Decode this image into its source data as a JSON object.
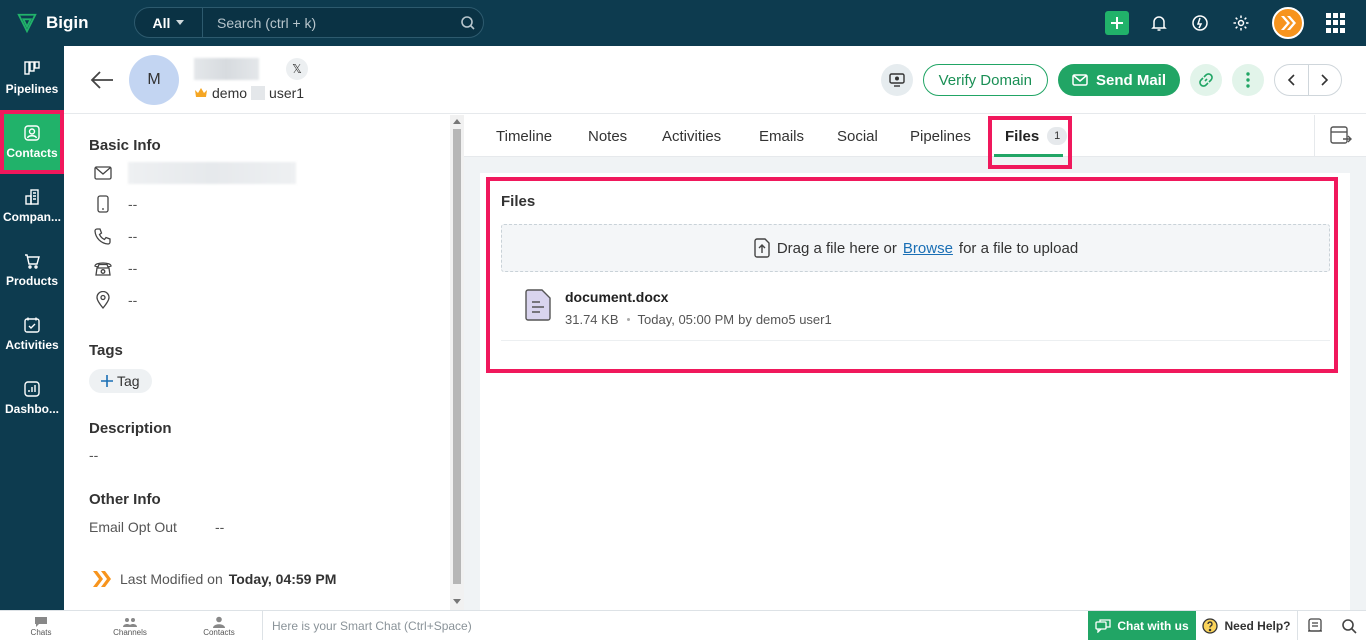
{
  "app": {
    "name": "Bigin"
  },
  "search": {
    "scope": "All",
    "placeholder": "Search (ctrl + k)"
  },
  "nav": {
    "items": [
      {
        "label": "Pipelines"
      },
      {
        "label": "Contacts"
      },
      {
        "label": "Compan..."
      },
      {
        "label": "Products"
      },
      {
        "label": "Activities"
      },
      {
        "label": "Dashbo..."
      }
    ]
  },
  "contact": {
    "avatar_initial": "M",
    "owner_prefix": "demo",
    "owner_suffix": "user1"
  },
  "header": {
    "verify_label": "Verify Domain",
    "send_label": "Send Mail"
  },
  "details": {
    "basic_info_title": "Basic Info",
    "mobile": "--",
    "phone": "--",
    "home_phone": "--",
    "address": "--",
    "tags_title": "Tags",
    "tag_button": "Tag",
    "description_title": "Description",
    "description_value": "--",
    "other_info_title": "Other Info",
    "email_opt_out_label": "Email Opt Out",
    "email_opt_out_value": "--",
    "last_modified_label": "Last Modified on",
    "last_modified_value": "Today, 04:59 PM"
  },
  "tabs": [
    {
      "label": "Timeline"
    },
    {
      "label": "Notes"
    },
    {
      "label": "Activities"
    },
    {
      "label": "Emails"
    },
    {
      "label": "Social"
    },
    {
      "label": "Pipelines"
    },
    {
      "label": "Files",
      "count": "1"
    }
  ],
  "files": {
    "title": "Files",
    "drop_prefix": "Drag a file here or",
    "drop_link": "Browse",
    "drop_suffix": "for a file to upload",
    "items": [
      {
        "name": "document.docx",
        "size": "31.74 KB",
        "time": "Today, 05:00 PM",
        "by_label": "by",
        "user": "demo5 user1"
      }
    ]
  },
  "bottom": {
    "chats": "Chats",
    "channels": "Channels",
    "contacts": "Contacts",
    "smartchat_placeholder": "Here is your Smart Chat (Ctrl+Space)",
    "chat_with_us": "Chat with us",
    "need_help": "Need Help?"
  },
  "colors": {
    "navy": "#0d3b4f",
    "green": "#21a565",
    "highlight": "#f0185c"
  }
}
